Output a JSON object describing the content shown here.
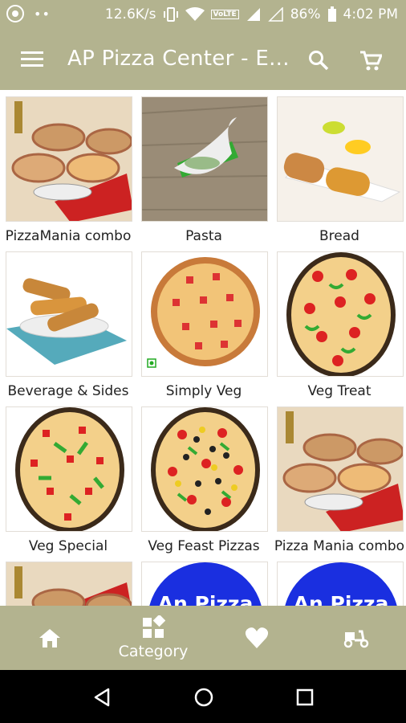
{
  "status_bar": {
    "speed": "12.6K/s",
    "battery": "86%",
    "time": "4:02 PM",
    "volte": "VoLTE"
  },
  "app_bar": {
    "title": "AP Pizza Center - E..."
  },
  "categories": [
    {
      "label": "PizzaMania combo",
      "image": "pizza-mania-combo-image"
    },
    {
      "label": "Pasta",
      "image": "pasta-image"
    },
    {
      "label": "Bread",
      "image": "garlic-bread-image"
    },
    {
      "label": "Beverage & Sides",
      "image": "bread-sticks-image"
    },
    {
      "label": "Simply Veg",
      "image": "simply-veg-pizza-image"
    },
    {
      "label": "Veg Treat",
      "image": "veg-treat-pizza-image"
    },
    {
      "label": "Veg Special",
      "image": "veg-special-pizza-image"
    },
    {
      "label": "Veg Feast Pizzas",
      "image": "veg-feast-pizza-image"
    },
    {
      "label": "Pizza Mania combo",
      "image": "pizza-mania-combo-image"
    },
    {
      "label": "",
      "image": "pizza-mania-combo-image"
    },
    {
      "label": "",
      "image": "ap-pizza-logo-image",
      "logo_text": "An Pizza"
    },
    {
      "label": "",
      "image": "ap-pizza-logo-image",
      "logo_text": "An Pizza"
    }
  ],
  "bottom_nav": {
    "items": [
      {
        "label": "",
        "icon": "home-icon"
      },
      {
        "label": "Category",
        "icon": "category-icon"
      },
      {
        "label": "",
        "icon": "heart-icon"
      },
      {
        "label": "",
        "icon": "delivery-scooter-icon"
      }
    ]
  },
  "colors": {
    "bar": "#b3b38f",
    "logo_blue": "#1a2fe0"
  }
}
